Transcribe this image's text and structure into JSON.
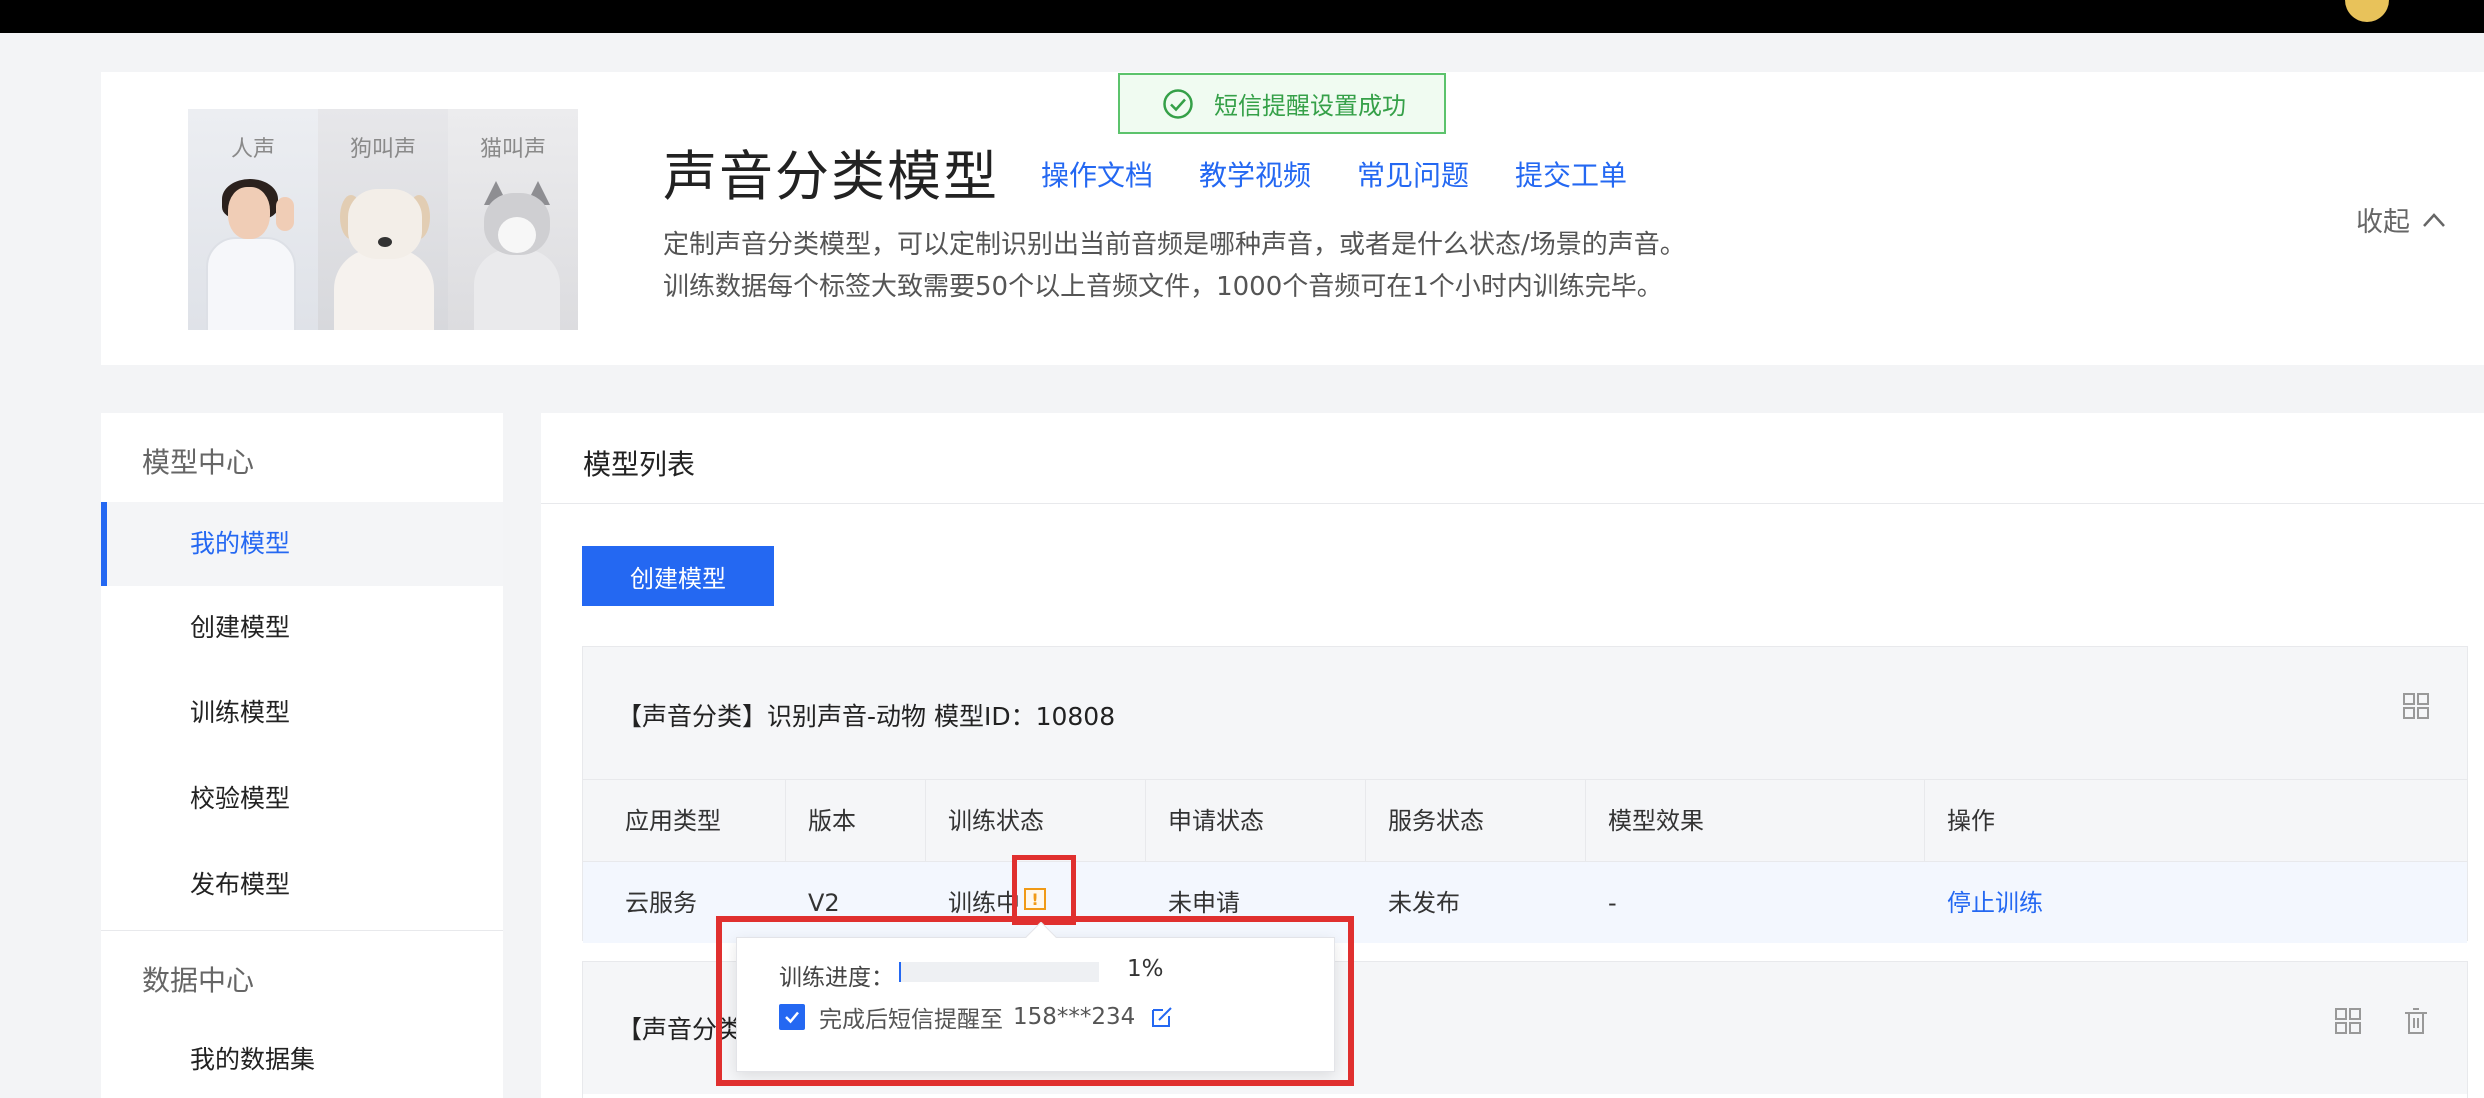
{
  "colors": {
    "accent": "#2468f2",
    "success": "#35a048",
    "warning": "#f09a16",
    "highlight": "#e0302f"
  },
  "banner": {
    "image_labels": [
      "人声",
      "狗叫声",
      "猫叫声"
    ],
    "title": "声音分类模型",
    "links": [
      "操作文档",
      "教学视频",
      "常见问题",
      "提交工单"
    ],
    "desc_line1": "定制声音分类模型，可以定制识别出当前音频是哪种声音，或者是什么状态/场景的声音。",
    "desc_line2": "训练数据每个标签大致需要50个以上音频文件，1000个音频可在1个小时内训练完毕。",
    "collapse_label": "收起"
  },
  "toast": {
    "text": "短信提醒设置成功",
    "icon": "check-circle-icon"
  },
  "sidebar": {
    "group1": "模型中心",
    "items1": [
      "我的模型",
      "创建模型",
      "训练模型",
      "校验模型",
      "发布模型"
    ],
    "active_item": "我的模型",
    "group2": "数据中心",
    "items2": [
      "我的数据集"
    ]
  },
  "main": {
    "title": "模型列表",
    "create_button": "创建模型",
    "card1": {
      "title": "【声音分类】识别声音-动物 模型ID：10808",
      "headers": [
        "应用类型",
        "版本",
        "训练状态",
        "申请状态",
        "服务状态",
        "模型效果",
        "操作"
      ],
      "row": {
        "app_type": "云服务",
        "version": "V2",
        "train_status": "训练中",
        "apply_status": "未申请",
        "service_status": "未发布",
        "effect": "-",
        "action": "停止训练"
      }
    },
    "card2": {
      "title_visible": "【声音分类"
    }
  },
  "popover": {
    "progress_label": "训练进度：",
    "progress_percent": "1%",
    "progress_value": 1,
    "check_text": "完成后短信提醒至",
    "phone": "158***234",
    "checked": true
  }
}
